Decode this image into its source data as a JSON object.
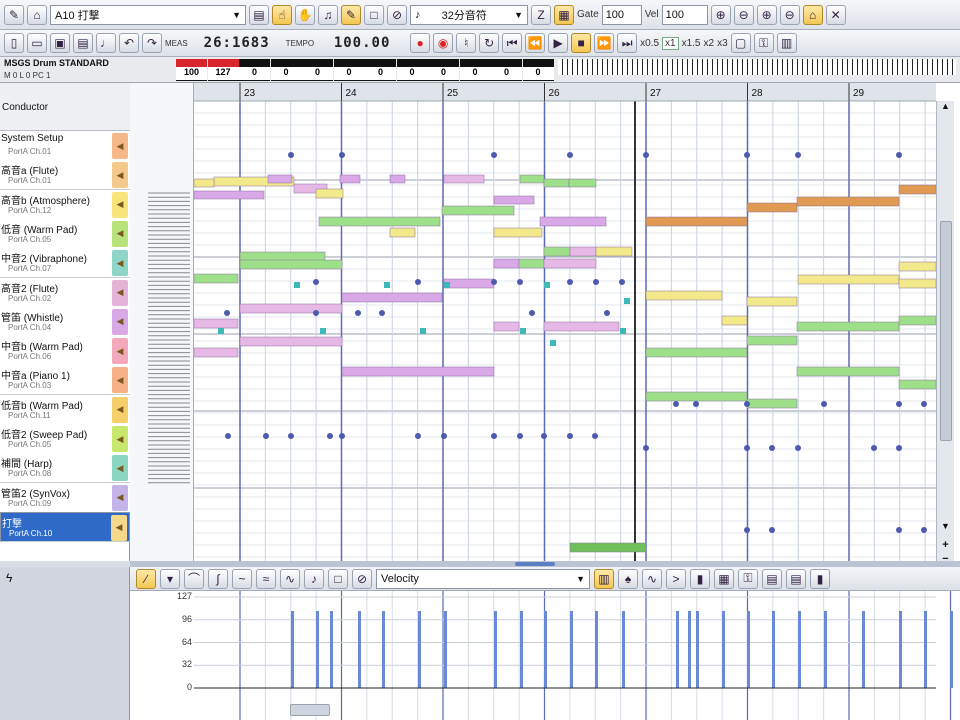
{
  "toolbar1": {
    "track_select": "A10 打撃",
    "grid_select": "32分音符",
    "gate_label": "Gate",
    "gate_value": "100",
    "vel_label": "Vel",
    "vel_value": "100"
  },
  "toolbar2": {
    "meas_label": "MEAS",
    "position": "26:1683",
    "tempo_label": "TEMPO",
    "tempo": "100.00",
    "zoom_x05": "x0.5",
    "zoom_x1": "x1",
    "zoom_x15": "x1.5",
    "zoom_x2": "x2",
    "zoom_x3": "x3"
  },
  "mixer": {
    "drum_name": "MSGS Drum STANDARD",
    "stats": "M 0  L 0  PC 1",
    "meters": [
      {
        "value": "100",
        "red": true
      },
      {
        "value": "127",
        "red": true
      },
      {
        "value": "0",
        "red": false
      },
      {
        "value": "0",
        "red": false
      },
      {
        "value": "0",
        "red": false
      },
      {
        "value": "0",
        "red": false
      },
      {
        "value": "0",
        "red": false
      },
      {
        "value": "0",
        "red": false
      },
      {
        "value": "0",
        "red": false
      },
      {
        "value": "0",
        "red": false
      },
      {
        "value": "0",
        "red": false
      },
      {
        "value": "0",
        "red": false
      }
    ]
  },
  "tracks": {
    "conductor": "Conductor",
    "items": [
      {
        "name": "System Setup",
        "port": "PortA Ch.01",
        "color": "#f5b886"
      },
      {
        "name": "高音a (Flute)",
        "port": "PortA Ch.01",
        "color": "#f5c98a"
      },
      {
        "name": "高音b (Atmosphere)",
        "port": "PortA Ch.12",
        "color": "#f7e57a"
      },
      {
        "name": "低音 (Warm Pad)",
        "port": "PortA Ch.05",
        "color": "#b8e37a"
      },
      {
        "name": "中音2 (Vibraphone)",
        "port": "PortA Ch.07",
        "color": "#8fd6c9"
      },
      {
        "name": "高音2 (Flute)",
        "port": "PortA Ch.02",
        "color": "#e5b3d6"
      },
      {
        "name": "管笛 (Whistle)",
        "port": "PortA Ch.04",
        "color": "#d9a8e6"
      },
      {
        "name": "中音b (Warm Pad)",
        "port": "PortA Ch.06",
        "color": "#f3a9bb"
      },
      {
        "name": "中音a (Piano 1)",
        "port": "PortA Ch.03",
        "color": "#f6b08a"
      },
      {
        "name": "低音b (Warm Pad)",
        "port": "PortA Ch.11",
        "color": "#f5cf6a"
      },
      {
        "name": "低音2 (Sweep Pad)",
        "port": "PortA Ch.05",
        "color": "#c9e66d"
      },
      {
        "name": "補間 (Harp)",
        "port": "PortA Ch.08",
        "color": "#8bd6bf"
      },
      {
        "name": "管笛2 (SynVox)",
        "port": "PortA Ch.09",
        "color": "#c4b4ea"
      },
      {
        "name": "打撃",
        "port": "PortA Ch.10",
        "color": "#f5d98a",
        "selected": true
      }
    ]
  },
  "roll": {
    "measures": [
      "23",
      "24",
      "25",
      "26",
      "27",
      "28",
      "29"
    ]
  },
  "velocity": {
    "mode": "Velocity",
    "ticks": [
      "127",
      "96",
      "64",
      "32",
      "0"
    ]
  }
}
